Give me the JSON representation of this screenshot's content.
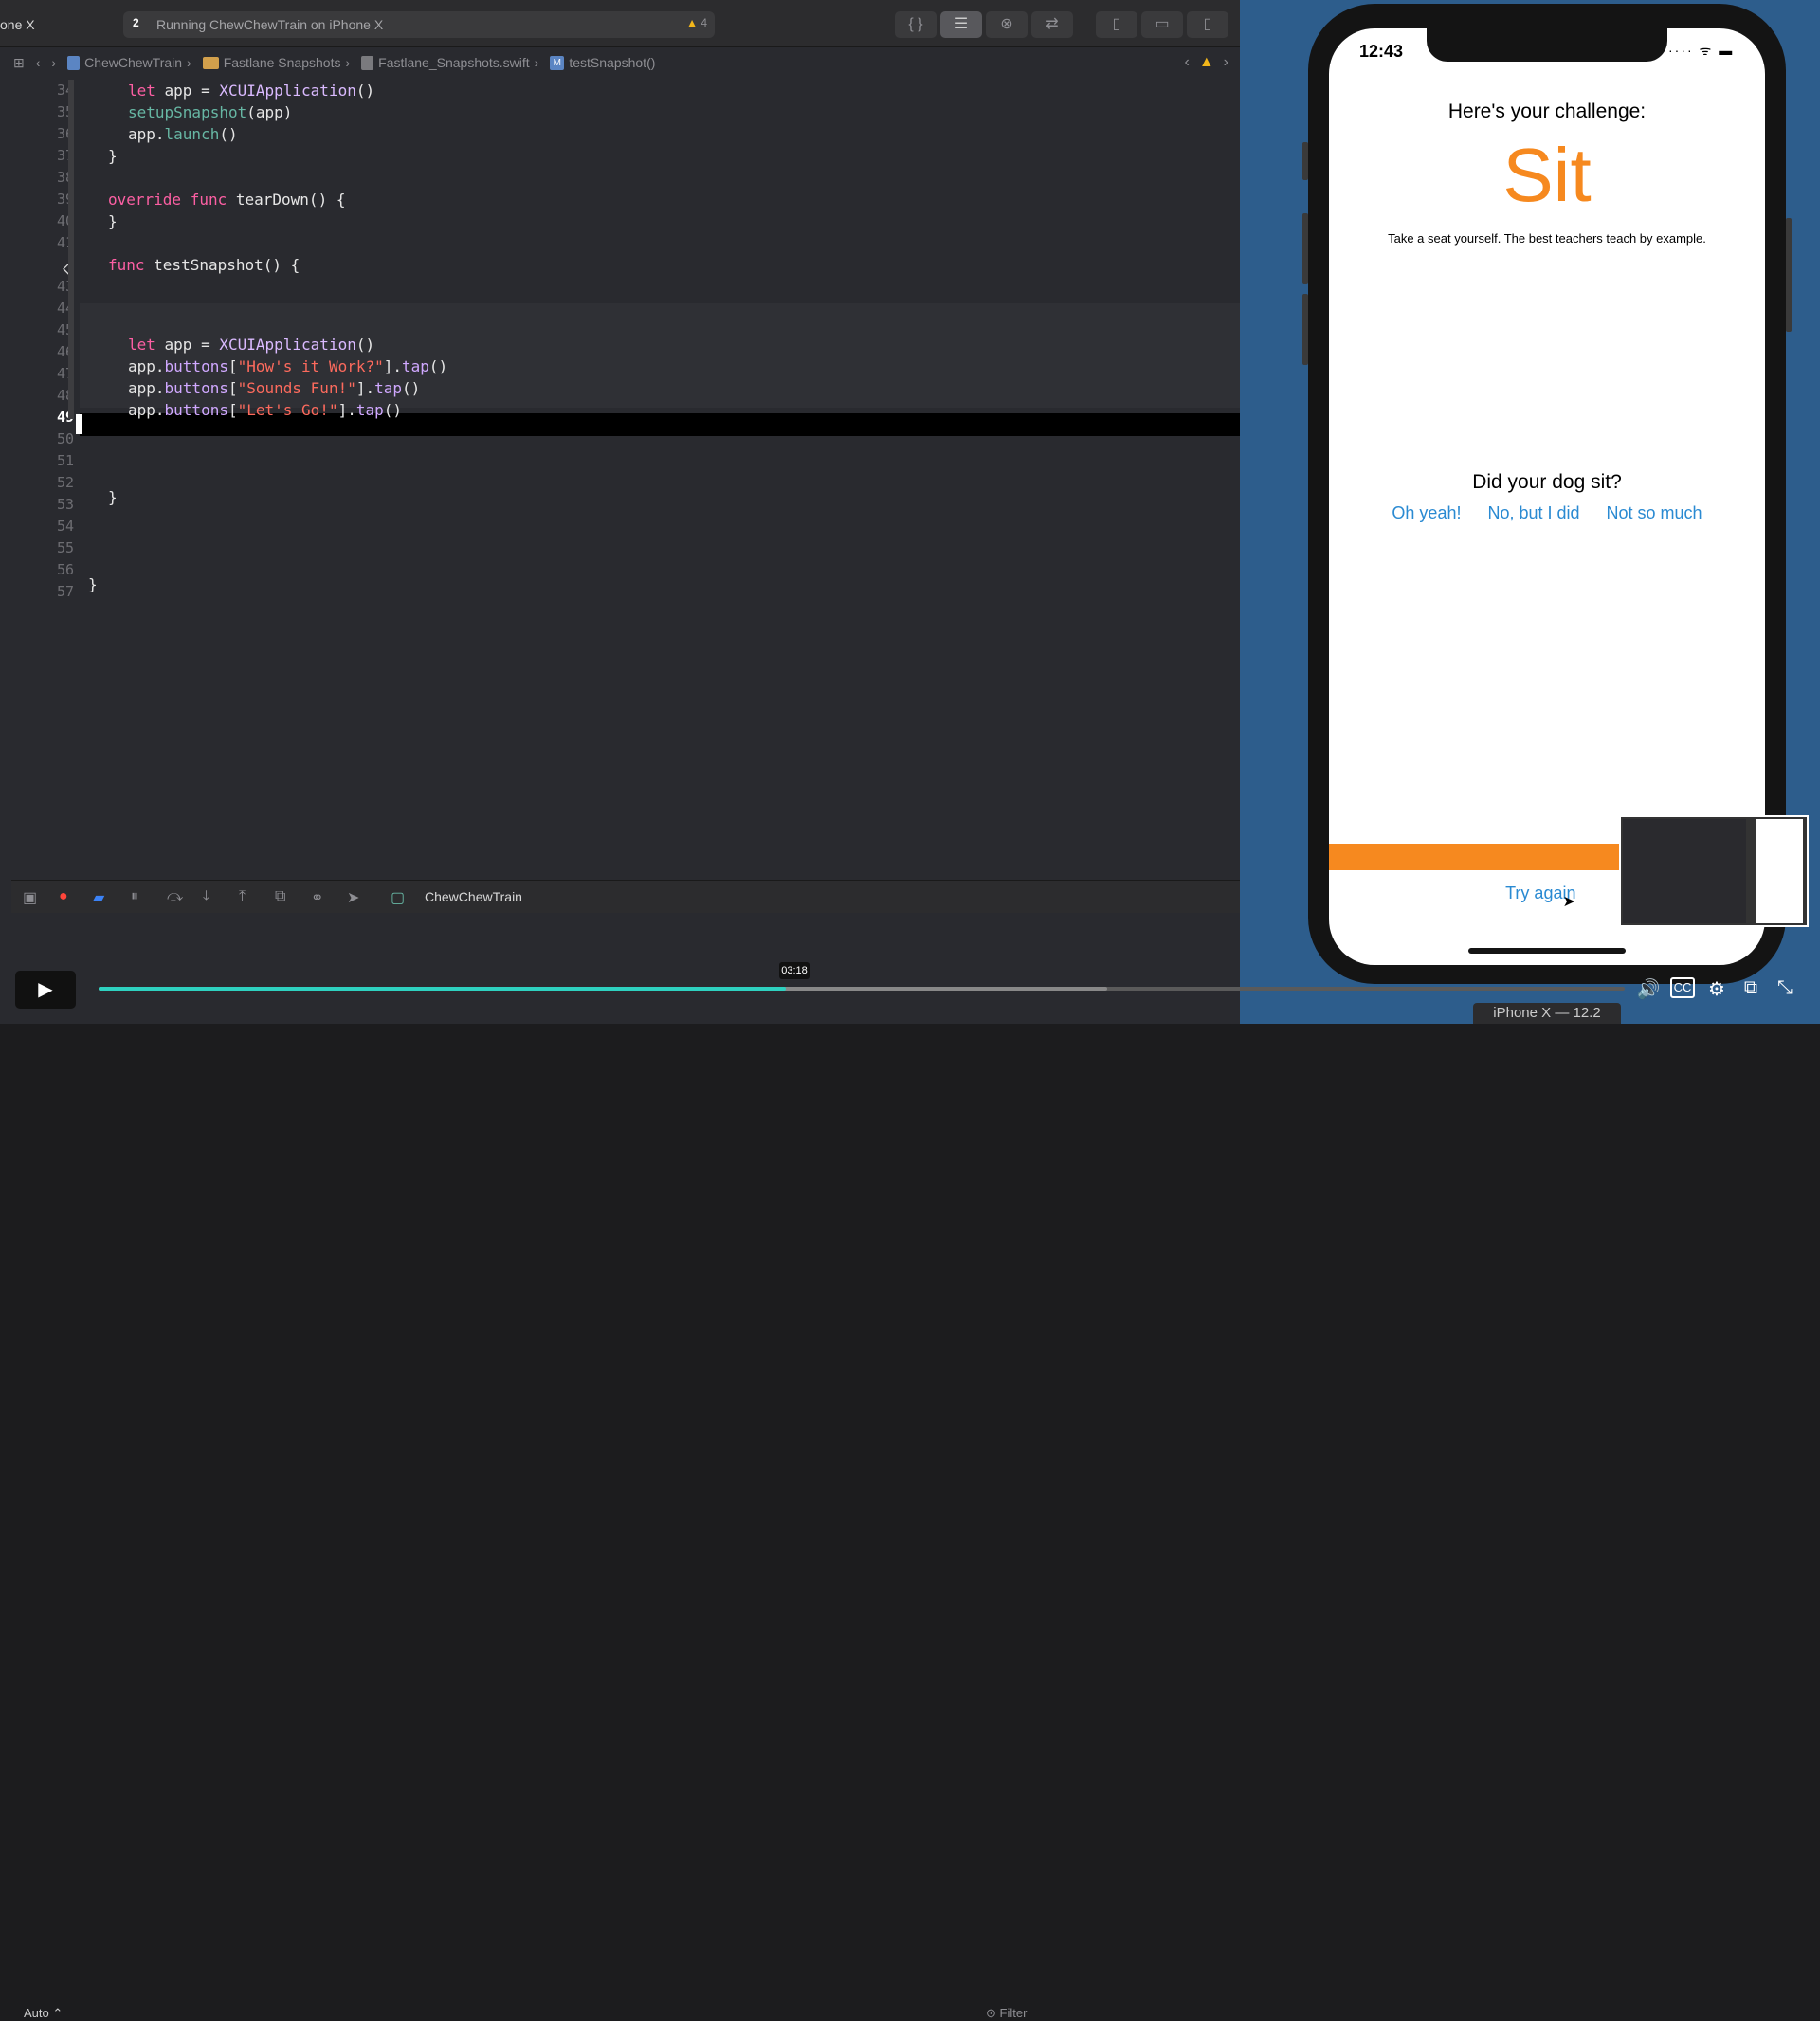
{
  "toolbar": {
    "scheme": "one X",
    "activity_num": "2",
    "activity_text": "Running ChewChewTrain on iPhone X",
    "warning_count": "4"
  },
  "jumpbar": {
    "crumbs": [
      "ChewChewTrain",
      "Fastlane Snapshots",
      "Fastlane_Snapshots.swift",
      "testSnapshot()"
    ]
  },
  "editor": {
    "line_numbers": [
      "34",
      "35",
      "36",
      "37",
      "38",
      "39",
      "40",
      "41",
      "42",
      "43",
      "44",
      "45",
      "46",
      "47",
      "48",
      "49",
      "50",
      "51",
      "52",
      "53",
      "54",
      "55",
      "56",
      "57"
    ],
    "current_line": "49"
  },
  "debug": {
    "target": "ChewChewTrain"
  },
  "simulator": {
    "time": "12:43",
    "status_icons": "···· ᯤ ▬",
    "challenge_label": "Here's your challenge:",
    "command": "Sit",
    "description": "Take a seat yourself. The best teachers teach by example.",
    "question": "Did your dog sit?",
    "answers": [
      "Oh yeah!",
      "No, but I did",
      "Not so much"
    ],
    "try_again": "Try again",
    "device_label": "iPhone X — 12.2"
  },
  "video": {
    "time_tooltip": "03:18",
    "progress": 0.45,
    "quality": "Auto",
    "filter_label": "Filter"
  },
  "colors": {
    "accent_orange": "#f6891f",
    "link_blue": "#2a8ad2",
    "progress_teal": "#2ed1c0"
  }
}
